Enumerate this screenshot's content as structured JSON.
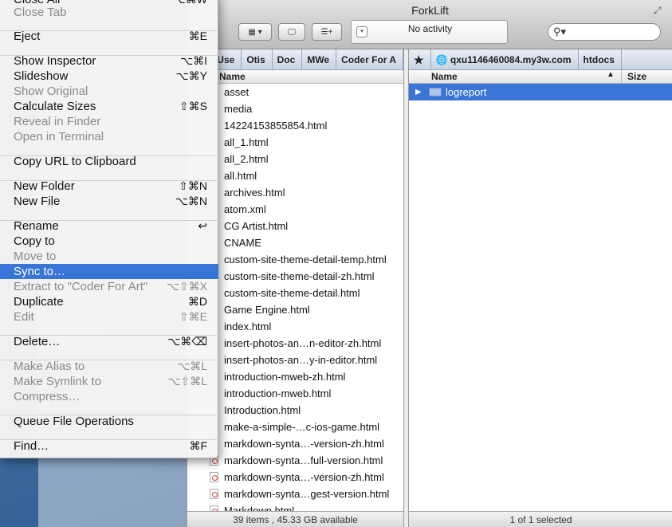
{
  "window": {
    "title": "ForkLift",
    "activity": "No activity",
    "search_placeholder": ""
  },
  "left_pane": {
    "breadcrumbs": [
      "Use",
      "Otis",
      "Doc",
      "MWe",
      "Coder For A"
    ],
    "column_name": "Name",
    "files": [
      "asset",
      "media",
      "14224153855854.html",
      "all_1.html",
      "all_2.html",
      "all.html",
      "archives.html",
      "atom.xml",
      "CG Artist.html",
      "CNAME",
      "custom-site-theme-detail-temp.html",
      "custom-site-theme-detail-zh.html",
      "custom-site-theme-detail.html",
      "Game Engine.html",
      "index.html",
      "insert-photos-an…n-editor-zh.html",
      "insert-photos-an…y-in-editor.html",
      "introduction-mweb-zh.html",
      "introduction-mweb.html",
      "Introduction.html",
      "make-a-simple-…c-ios-game.html",
      "markdown-synta…-version-zh.html",
      "markdown-synta…full-version.html",
      "markdown-synta…-version-zh.html",
      "markdown-synta…gest-version.html",
      "Markdown.html"
    ],
    "status": "39 items , 45.33 GB available"
  },
  "right_pane": {
    "host": "qxu1146460084.my3w.com",
    "folder": "htdocs",
    "column_name": "Name",
    "column_size": "Size",
    "items": [
      "logreport"
    ],
    "status": "1 of 1 selected"
  },
  "menu": {
    "items": [
      {
        "label": "Close All",
        "shortcut": "⌥⌘W",
        "disabled": false
      },
      {
        "label": "Close Tab",
        "shortcut": "",
        "disabled": true
      },
      {
        "label": "Eject",
        "shortcut": "⌘E",
        "disabled": false
      },
      {
        "label": "Show Inspector",
        "shortcut": "⌥⌘I",
        "disabled": false
      },
      {
        "label": "Slideshow",
        "shortcut": "⌥⌘Y",
        "disabled": false
      },
      {
        "label": "Show Original",
        "shortcut": "",
        "disabled": true
      },
      {
        "label": "Calculate Sizes",
        "shortcut": "⇧⌘S",
        "disabled": false
      },
      {
        "label": "Reveal in Finder",
        "shortcut": "",
        "disabled": true
      },
      {
        "label": "Open in Terminal",
        "shortcut": "",
        "disabled": true
      },
      {
        "label": "Copy URL to Clipboard",
        "shortcut": "",
        "disabled": false
      },
      {
        "label": "New Folder",
        "shortcut": "⇧⌘N",
        "disabled": false
      },
      {
        "label": "New File",
        "shortcut": "⌥⌘N",
        "disabled": false
      },
      {
        "label": "Rename",
        "shortcut": "↩",
        "disabled": false
      },
      {
        "label": "Copy to",
        "shortcut": "",
        "disabled": false
      },
      {
        "label": "Move to",
        "shortcut": "",
        "disabled": true
      },
      {
        "label": "Sync to…",
        "shortcut": "",
        "disabled": false
      },
      {
        "label": "Extract to \"Coder For Art\"",
        "shortcut": "⌥⇧⌘X",
        "disabled": true
      },
      {
        "label": "Duplicate",
        "shortcut": "⌘D",
        "disabled": false
      },
      {
        "label": "Edit",
        "shortcut": "⇧⌘E",
        "disabled": true
      },
      {
        "label": "Delete…",
        "shortcut": "⌥⌘⌫",
        "disabled": false
      },
      {
        "label": "Make Alias to",
        "shortcut": "⌥⌘L",
        "disabled": true
      },
      {
        "label": "Make Symlink to",
        "shortcut": "⌥⇧⌘L",
        "disabled": true
      },
      {
        "label": "Compress…",
        "shortcut": "",
        "disabled": true
      },
      {
        "label": "Queue File Operations",
        "shortcut": "",
        "disabled": false
      },
      {
        "label": "Find…",
        "shortcut": "⌘F",
        "disabled": false
      }
    ]
  },
  "colors": {
    "selection": "#3875d7",
    "menu_bg": "#f5f5f5"
  }
}
